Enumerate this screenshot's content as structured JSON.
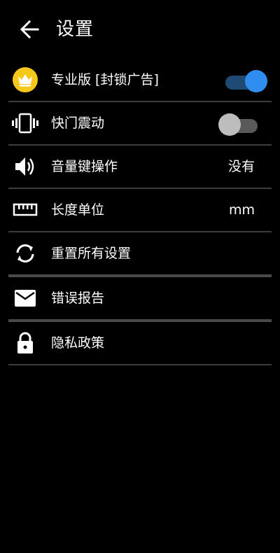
{
  "header": {
    "title": "设置",
    "back_icon": "arrow-left-icon"
  },
  "colors": {
    "background": "#000000",
    "accent": "#2f8df0",
    "crown_badge": "#f6c81a",
    "divider": "#3c3c3c"
  },
  "settings": {
    "pro": {
      "icon": "crown-icon",
      "label": "专业版 [封锁广告]",
      "toggle_on": true
    },
    "vibrate": {
      "icon": "vibration-icon",
      "label": "快门震动",
      "toggle_on": false
    },
    "volume_keys": {
      "icon": "speaker-icon",
      "label": "音量键操作",
      "value": "没有"
    },
    "length_unit": {
      "icon": "ruler-icon",
      "label": "长度单位",
      "value": "mm"
    },
    "reset": {
      "icon": "refresh-icon",
      "label": "重置所有设置"
    },
    "error_report": {
      "icon": "mail-icon",
      "label": "错误报告"
    },
    "privacy": {
      "icon": "lock-icon",
      "label": "隐私政策"
    }
  }
}
